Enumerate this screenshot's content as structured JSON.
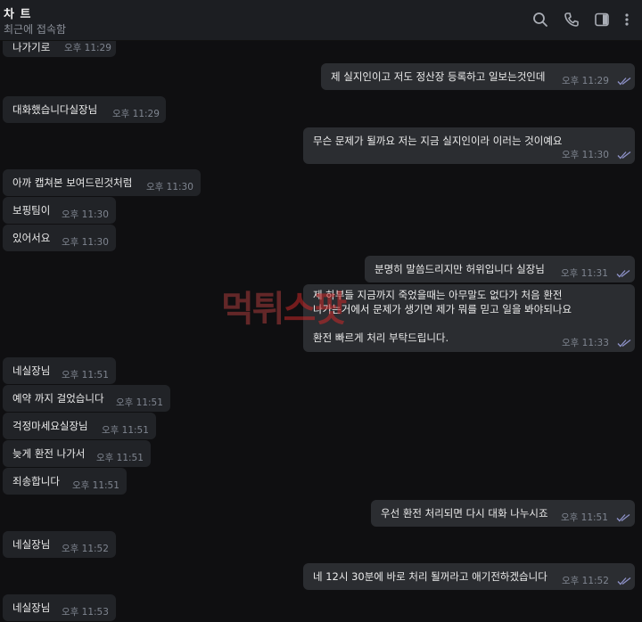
{
  "header": {
    "title": "차 트",
    "status": "최근에 접속함",
    "icons": [
      "search-icon",
      "phone-icon",
      "sidebar-icon",
      "more-icon"
    ]
  },
  "watermark": {
    "main": "먹튀",
    "accent": "스팟"
  },
  "messages": [
    {
      "dir": "in",
      "text": "나가기로",
      "time": "오후 11:29"
    },
    {
      "dir": "out",
      "text": "제 실지인이고 저도 정산장 등록하고 일보는것인데",
      "time": "오후 11:29",
      "read": true
    },
    {
      "dir": "in",
      "text": "대화했습니다실장님",
      "time": "오후 11:29"
    },
    {
      "dir": "out",
      "text": "무슨 문제가 될까요 저는 지금 실지인이라 이러는 것이예요",
      "time": "오후 11:30",
      "read": true
    },
    {
      "dir": "in",
      "text": "아까 캡쳐본 보여드린것처럼",
      "time": "오후 11:30"
    },
    {
      "dir": "in",
      "text": "보핑팀이",
      "time": "오후 11:30"
    },
    {
      "dir": "in",
      "text": "있어서요",
      "time": "오후 11:30"
    },
    {
      "dir": "out",
      "text": "분명히 말씀드리지만 허위입니다 실장님",
      "time": "오후 11:31",
      "read": true
    },
    {
      "dir": "out",
      "text": "제 하부들 지금까지 죽었을때는 아무말도 없다가 처음 환전\n나가는거에서 문제가 생기면 제가 뭐를 믿고 일을 봐야되나요\n\n환전 빠르게 처리 부탁드립니다.",
      "time": "오후 11:33",
      "read": true
    },
    {
      "dir": "in",
      "text": "네실장님",
      "time": "오후 11:51"
    },
    {
      "dir": "in",
      "text": "예약 까지 걸었습니다",
      "time": "오후 11:51"
    },
    {
      "dir": "in",
      "text": "걱정마세요실장님",
      "time": "오후 11:51"
    },
    {
      "dir": "in",
      "text": "늦게 환전 나가서",
      "time": "오후 11:51"
    },
    {
      "dir": "in",
      "text": "죄송합니다",
      "time": "오후 11:51"
    },
    {
      "dir": "out",
      "text": "우선 환전 처리되면 다시 대화 나누시죠",
      "time": "오후 11:51",
      "read": true
    },
    {
      "dir": "in",
      "text": "네실장님",
      "time": "오후 11:52"
    },
    {
      "dir": "out",
      "text": "네 12시 30분에 바로 처리 될꺼라고 애기전하겠습니다",
      "time": "오후 11:52",
      "read": true
    },
    {
      "dir": "in",
      "text": "네실장님",
      "time": "오후 11:53"
    }
  ]
}
